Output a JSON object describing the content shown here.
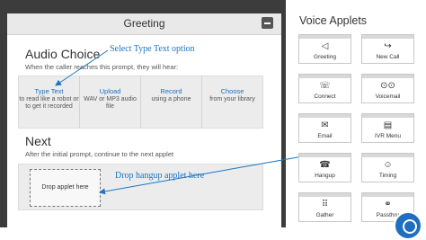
{
  "greeting": {
    "title": "Greeting",
    "audio_choice_title": "Audio Choice",
    "audio_choice_sub": "When the caller reaches this prompt, they will hear:",
    "choices": [
      {
        "label": "Type Text",
        "desc": "to read like a robot or to get it recorded"
      },
      {
        "label": "Upload",
        "desc": "WAV or MP3 audio file"
      },
      {
        "label": "Record",
        "desc": "using a phone"
      },
      {
        "label": "Choose",
        "desc": "from your library"
      }
    ],
    "next_title": "Next",
    "next_sub": "After the initial prompt, continue to the next applet",
    "drop_placeholder": "Drop applet here"
  },
  "annotations": {
    "select_type_text": "Select Type Text option",
    "drop_hangup": "Drop hangup applet here"
  },
  "applets": {
    "title": "Voice Applets",
    "items": [
      {
        "label": "Greeting",
        "icon": "megaphone-icon",
        "glyph": "◁"
      },
      {
        "label": "New Call",
        "icon": "forward-call-icon",
        "glyph": "↪"
      },
      {
        "label": "Connect",
        "icon": "phone-handset-icon",
        "glyph": "☏"
      },
      {
        "label": "Voicemail",
        "icon": "voicemail-icon",
        "glyph": "⊙⊙"
      },
      {
        "label": "Email",
        "icon": "envelope-icon",
        "glyph": "✉"
      },
      {
        "label": "IVR Menu",
        "icon": "ivr-menu-icon",
        "glyph": "▤"
      },
      {
        "label": "Hangup",
        "icon": "hangup-icon",
        "glyph": "☎"
      },
      {
        "label": "Timing",
        "icon": "monkey-icon",
        "glyph": "☺"
      },
      {
        "label": "Gather",
        "icon": "keypad-icon",
        "glyph": "⠿"
      },
      {
        "label": "Passthru",
        "icon": "link-icon",
        "glyph": "⚭"
      }
    ]
  },
  "colors": {
    "accent": "#1a75c2",
    "panel_bg": "#3c3c3c"
  }
}
